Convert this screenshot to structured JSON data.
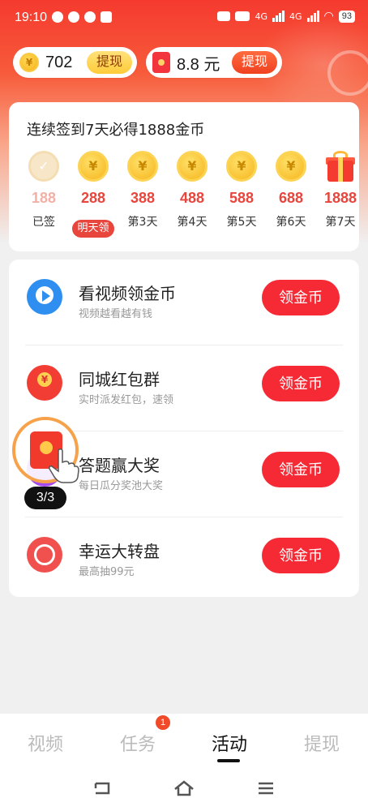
{
  "status_bar": {
    "time": "19:10",
    "network_label_1": "4G",
    "network_label_2": "4G",
    "battery": "93"
  },
  "balance": {
    "coins": "702",
    "coins_withdraw": "提现",
    "cash": "8.8 元",
    "cash_withdraw": "提现"
  },
  "sign_in": {
    "title": "连续签到7天必得1888金币",
    "days": [
      {
        "reward": "188",
        "label": "已签",
        "state": "signed"
      },
      {
        "reward": "288",
        "label": "明天领",
        "state": "tomorrow"
      },
      {
        "reward": "388",
        "label": "第3天",
        "state": "pending"
      },
      {
        "reward": "488",
        "label": "第4天",
        "state": "pending"
      },
      {
        "reward": "588",
        "label": "第5天",
        "state": "pending"
      },
      {
        "reward": "688",
        "label": "第6天",
        "state": "pending"
      },
      {
        "reward": "1888",
        "label": "第7天",
        "state": "gift"
      }
    ]
  },
  "tasks": [
    {
      "title": "看视频领金币",
      "subtitle": "视频越看越有钱",
      "button": "领金币",
      "icon": "video-play-icon"
    },
    {
      "title": "同城红包群",
      "subtitle": "实时派发红包，速领",
      "button": "领金币",
      "icon": "red-envelope-icon"
    },
    {
      "title": "答题赢大奖",
      "subtitle": "每日瓜分奖池大奖",
      "button": "领金币",
      "icon": "quiz-icon"
    },
    {
      "title": "幸运大转盘",
      "subtitle": "最高抽99元",
      "button": "领金币",
      "icon": "lucky-wheel-icon"
    }
  ],
  "floating_packet": {
    "counter": "3/3"
  },
  "bottom_nav": {
    "tabs": [
      "视频",
      "任务",
      "活动",
      "提现"
    ],
    "active": "活动",
    "task_badge": "1"
  },
  "colors": {
    "accent_red": "#f52a35",
    "reward_red": "#e8453c",
    "header_gradient_top": "#f53a2f"
  }
}
